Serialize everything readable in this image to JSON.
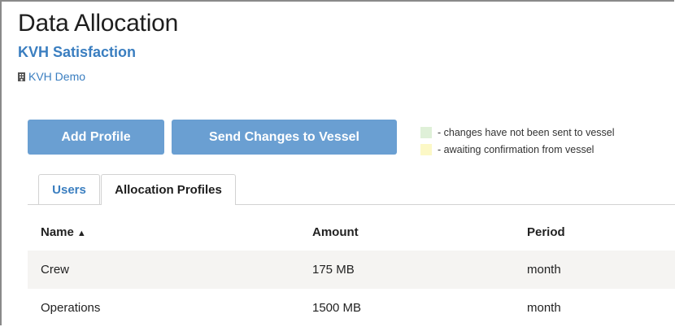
{
  "header": {
    "title": "Data Allocation",
    "subtitle": "KVH Satisfaction",
    "account": "KVH Demo",
    "account_icon": "building-icon"
  },
  "toolbar": {
    "add_label": "Add Profile",
    "send_label": "Send Changes to Vessel"
  },
  "legend": {
    "items": [
      {
        "text": "- changes have not been sent to vessel",
        "color": "#dff0d8"
      },
      {
        "text": "- awaiting confirmation from vessel",
        "color": "#fcf8c6"
      }
    ]
  },
  "tabs": [
    {
      "label": "Users",
      "active": false
    },
    {
      "label": "Allocation Profiles",
      "active": true
    }
  ],
  "table": {
    "columns": [
      "Name",
      "Amount",
      "Period"
    ],
    "sort_indicator": "▲",
    "rows": [
      {
        "name": "Crew",
        "amount": "175 MB",
        "period": "month"
      },
      {
        "name": "Operations",
        "amount": "1500 MB",
        "period": "month"
      }
    ]
  },
  "colors": {
    "accent": "#3a7ec0",
    "button": "#6a9fd2"
  }
}
